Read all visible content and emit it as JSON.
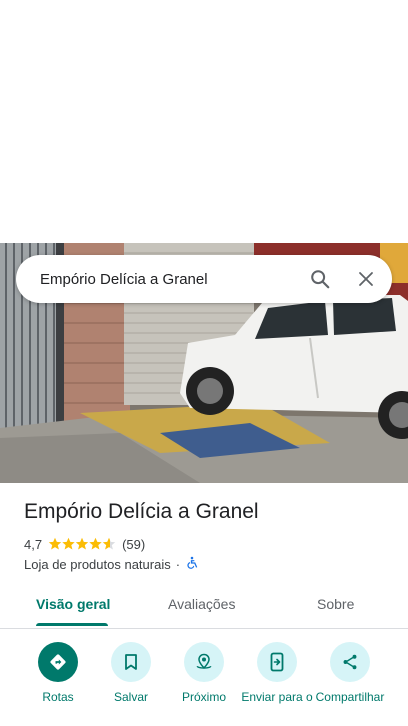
{
  "search": {
    "query": "Empório Delícia a Granel"
  },
  "place": {
    "name": "Empório Delícia a Granel",
    "rating": "4,7",
    "stars": 4.7,
    "reviews_count": "(59)",
    "category": "Loja de produtos naturais",
    "separator": "·"
  },
  "tabs": [
    {
      "label": "Visão geral",
      "active": true
    },
    {
      "label": "Avaliações",
      "active": false
    },
    {
      "label": "Sobre",
      "active": false
    }
  ],
  "actions": [
    {
      "label": "Rotas",
      "icon": "directions-icon"
    },
    {
      "label": "Salvar",
      "icon": "bookmark-icon"
    },
    {
      "label": "Próximo",
      "icon": "nearby-icon"
    },
    {
      "label": "Enviar para o",
      "icon": "send-to-phone-icon"
    },
    {
      "label": "Compartilhar",
      "icon": "share-icon"
    }
  ],
  "colors": {
    "accent": "#00796b",
    "action_bg": "#d6f4f7",
    "star": "#fbbc04",
    "accessible": "#1a73e8"
  }
}
